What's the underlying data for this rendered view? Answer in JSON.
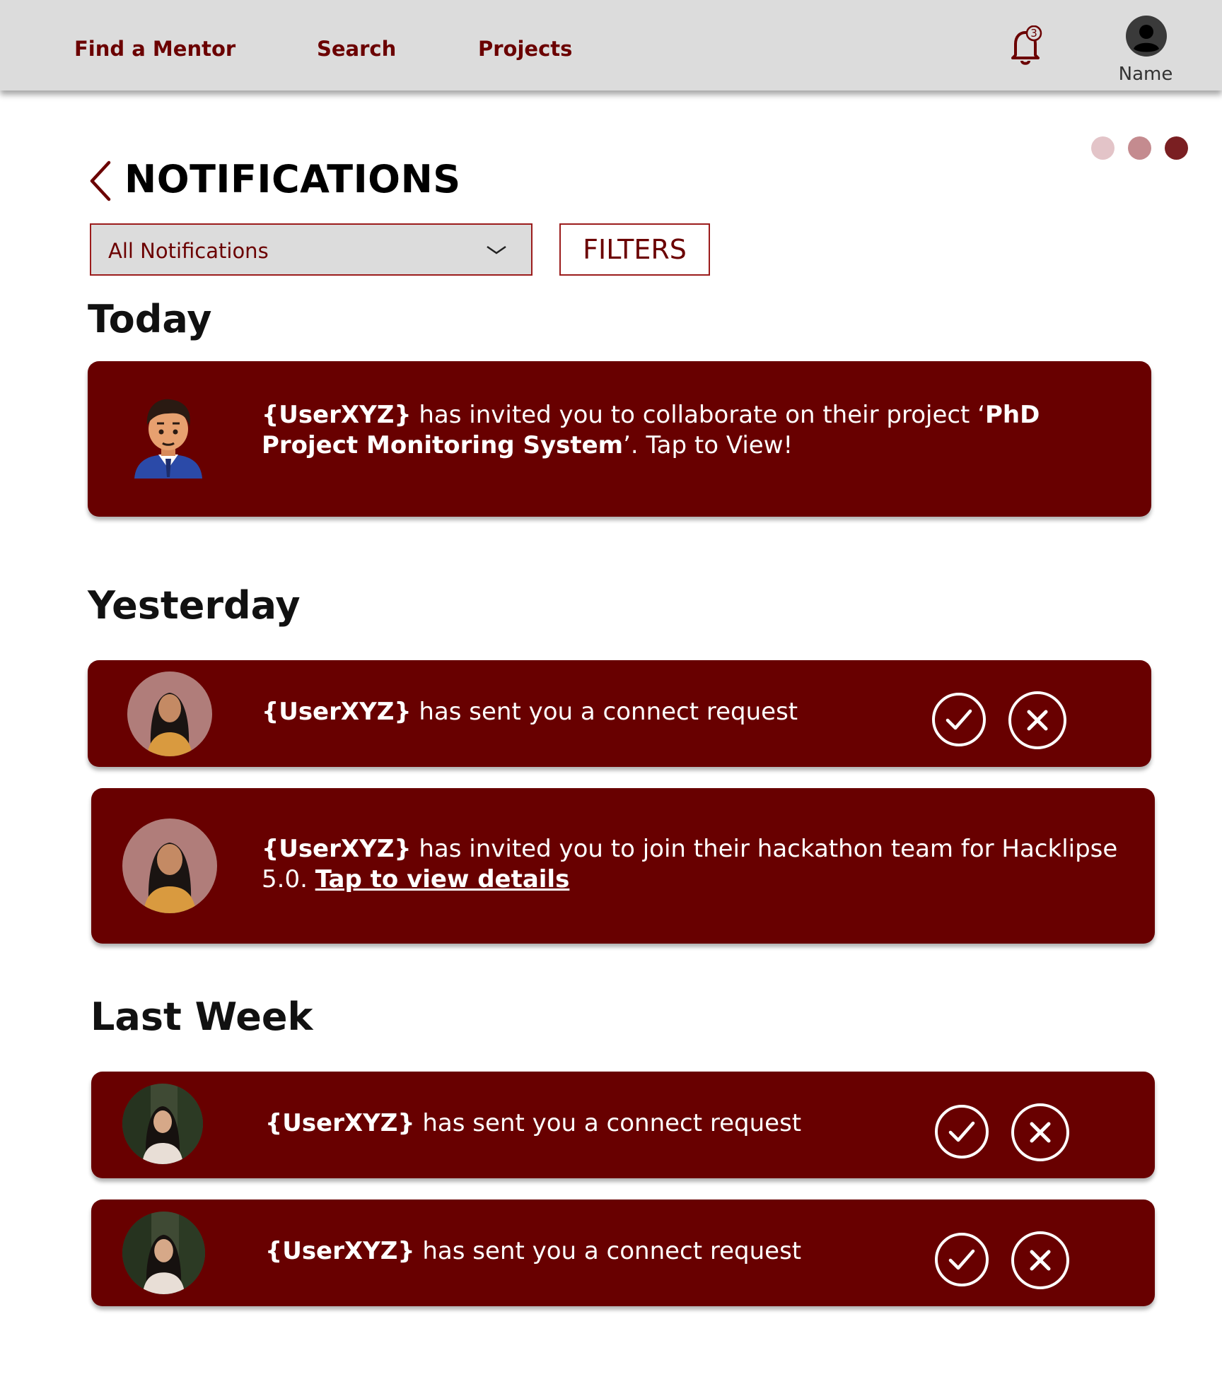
{
  "nav": {
    "links": [
      "Find a Mentor",
      "Search",
      "Projects"
    ],
    "notification_count": "3",
    "user_name": "Name"
  },
  "steps": {
    "colors": [
      "#e3c4c8",
      "#c48b8f",
      "#7a1f22"
    ]
  },
  "page": {
    "title": "NOTIFICATIONS",
    "dropdown_value": "All Notifications",
    "filters_label": "FILTERS"
  },
  "sections": {
    "today": "Today",
    "yesterday": "Yesterday",
    "last_week": "Last Week"
  },
  "notifications": [
    {
      "user": "{UserXYZ}",
      "text_a": " has invited you to collaborate on their project ‘",
      "project": "PhD Project Monitoring System",
      "text_b": "’. Tap to View!"
    },
    {
      "user": "{UserXYZ}",
      "text": " has sent you a connect request"
    },
    {
      "user": "{UserXYZ}",
      "text": " has invited you to join their hackathon team for Hacklipse 5.0. ",
      "link": "Tap to view details"
    },
    {
      "user": "{UserXYZ}",
      "text": " has sent you a connect request"
    },
    {
      "user": "{UserXYZ}",
      "text": " has sent you a connect request"
    }
  ],
  "colors": {
    "brand": "#680000",
    "accent_text": "#6b0000",
    "nav_bg": "#dcdcdc"
  }
}
